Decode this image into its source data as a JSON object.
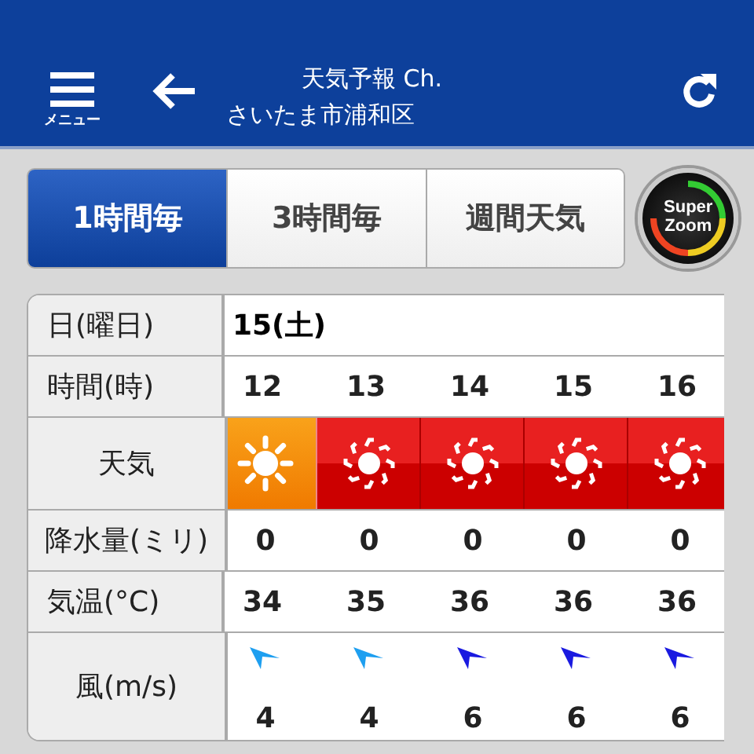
{
  "header": {
    "menu_label": "メニュー",
    "title": "天気予報 Ch.",
    "location": "さいたま市浦和区"
  },
  "tabs": [
    {
      "label": "1時間毎",
      "selected": true
    },
    {
      "label": "3時間毎",
      "selected": false
    },
    {
      "label": "週間天気",
      "selected": false
    }
  ],
  "super_zoom": {
    "line1": "Super",
    "line2": "Zoom"
  },
  "table": {
    "labels": {
      "day": "日(曜日)",
      "time": "時間(時)",
      "weather": "天気",
      "rain": "降水量(ミリ)",
      "temp": "気温(°C)",
      "wind": "風(m/s)"
    },
    "day": "15(土)",
    "hours": [
      {
        "time": "12",
        "weather": {
          "kind": "sun"
        },
        "rain": "0",
        "temp": "34",
        "wind": {
          "speed": "4",
          "color": "#1e9ff0"
        }
      },
      {
        "time": "13",
        "weather": {
          "kind": "hot"
        },
        "rain": "0",
        "temp": "35",
        "wind": {
          "speed": "4",
          "color": "#1e9ff0"
        }
      },
      {
        "time": "14",
        "weather": {
          "kind": "hot"
        },
        "rain": "0",
        "temp": "36",
        "wind": {
          "speed": "6",
          "color": "#1a1ae0"
        }
      },
      {
        "time": "15",
        "weather": {
          "kind": "hot"
        },
        "rain": "0",
        "temp": "36",
        "wind": {
          "speed": "6",
          "color": "#1a1ae0"
        }
      },
      {
        "time": "16",
        "weather": {
          "kind": "hot"
        },
        "rain": "0",
        "temp": "36",
        "wind": {
          "speed": "6",
          "color": "#1a1ae0"
        }
      }
    ]
  }
}
